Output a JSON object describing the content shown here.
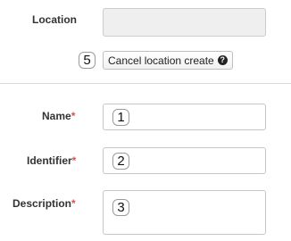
{
  "form": {
    "location": {
      "label": "Location",
      "value": ""
    },
    "cancel_button": {
      "label": "Cancel location create",
      "marker": "5"
    },
    "name": {
      "label": "Name",
      "required_mark": "*",
      "marker": "1"
    },
    "identifier": {
      "label": "Identifier",
      "required_mark": "*",
      "marker": "2"
    },
    "description": {
      "label": "Description",
      "required_mark": "*",
      "marker": "3"
    }
  },
  "icons": {
    "help": "question-circle-icon"
  },
  "colors": {
    "required": "#d9534f",
    "disabled_field": "#efefef",
    "border": "#c6c6c6"
  }
}
